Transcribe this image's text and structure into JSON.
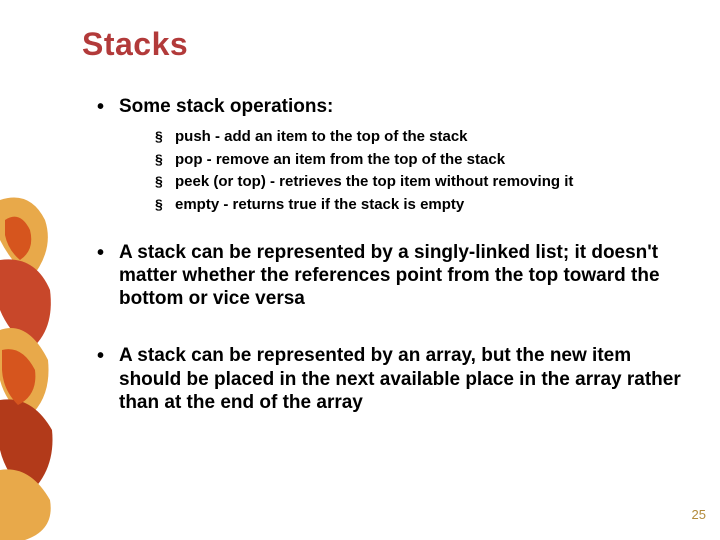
{
  "title": "Stacks",
  "section_heading": "Some stack operations:",
  "sub_items": [
    "push - add an item to the top of the stack",
    "pop - remove an item from the top of the stack",
    "peek (or top) - retrieves the top item without removing it",
    "empty - returns true if the stack is empty"
  ],
  "para_linked_list": "A stack can be represented by a singly-linked list; it doesn't matter whether the references point from the top toward the bottom or vice versa",
  "para_array": "A stack can be represented by an array, but the new item should be placed in the next available place in the array rather than at the end of the array",
  "page_number": "25"
}
